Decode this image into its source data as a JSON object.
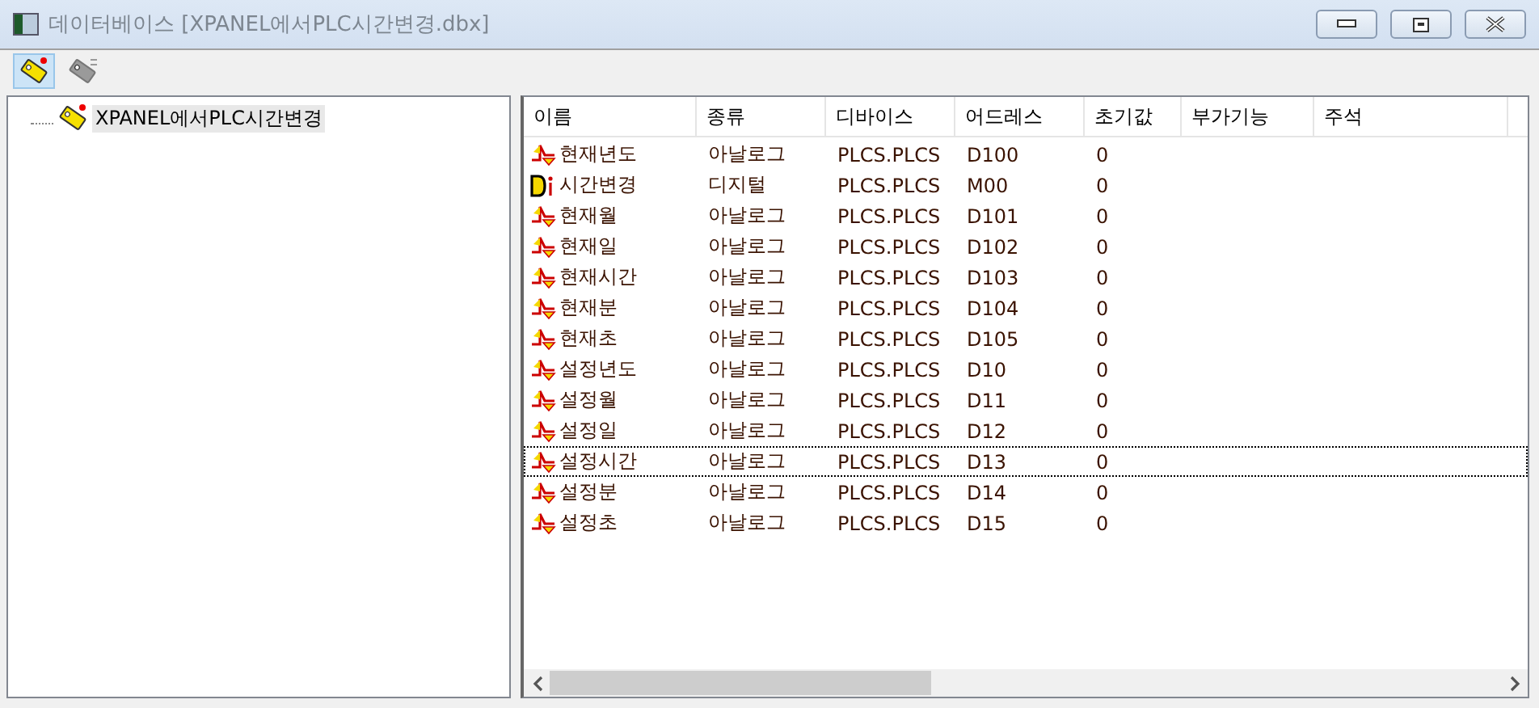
{
  "window": {
    "title": "데이터베이스 [XPANEL에서PLC시간변경.dbx]"
  },
  "toolbar": [
    {
      "kind": "tag-new",
      "pressed": true,
      "disabled": false
    },
    {
      "kind": "tag-edit",
      "pressed": false,
      "disabled": true
    }
  ],
  "tree": {
    "items": [
      {
        "label": "XPANEL에서PLC시간변경",
        "selected": true
      }
    ]
  },
  "table": {
    "columns": [
      "이름",
      "종류",
      "디바이스",
      "어드레스",
      "초기값",
      "부가기능",
      "주석"
    ],
    "rows": [
      {
        "kind": "analog",
        "cells": [
          "현재년도",
          "아날로그",
          "PLCS.PLCS",
          "D100",
          "0"
        ],
        "focused": false
      },
      {
        "kind": "digital",
        "cells": [
          "시간변경",
          "디지털",
          "PLCS.PLCS",
          "M00",
          "0"
        ],
        "focused": false
      },
      {
        "kind": "analog",
        "cells": [
          "현재월",
          "아날로그",
          "PLCS.PLCS",
          "D101",
          "0"
        ],
        "focused": false
      },
      {
        "kind": "analog",
        "cells": [
          "현재일",
          "아날로그",
          "PLCS.PLCS",
          "D102",
          "0"
        ],
        "focused": false
      },
      {
        "kind": "analog",
        "cells": [
          "현재시간",
          "아날로그",
          "PLCS.PLCS",
          "D103",
          "0"
        ],
        "focused": false
      },
      {
        "kind": "analog",
        "cells": [
          "현재분",
          "아날로그",
          "PLCS.PLCS",
          "D104",
          "0"
        ],
        "focused": false
      },
      {
        "kind": "analog",
        "cells": [
          "현재초",
          "아날로그",
          "PLCS.PLCS",
          "D105",
          "0"
        ],
        "focused": false
      },
      {
        "kind": "analog",
        "cells": [
          "설정년도",
          "아날로그",
          "PLCS.PLCS",
          "D10",
          "0"
        ],
        "focused": false
      },
      {
        "kind": "analog",
        "cells": [
          "설정월",
          "아날로그",
          "PLCS.PLCS",
          "D11",
          "0"
        ],
        "focused": false
      },
      {
        "kind": "analog",
        "cells": [
          "설정일",
          "아날로그",
          "PLCS.PLCS",
          "D12",
          "0"
        ],
        "focused": false
      },
      {
        "kind": "analog",
        "cells": [
          "설정시간",
          "아날로그",
          "PLCS.PLCS",
          "D13",
          "0"
        ],
        "focused": true
      },
      {
        "kind": "analog",
        "cells": [
          "설정분",
          "아날로그",
          "PLCS.PLCS",
          "D14",
          "0"
        ],
        "focused": false
      },
      {
        "kind": "analog",
        "cells": [
          "설정초",
          "아날로그",
          "PLCS.PLCS",
          "D15",
          "0"
        ],
        "focused": false
      }
    ]
  }
}
